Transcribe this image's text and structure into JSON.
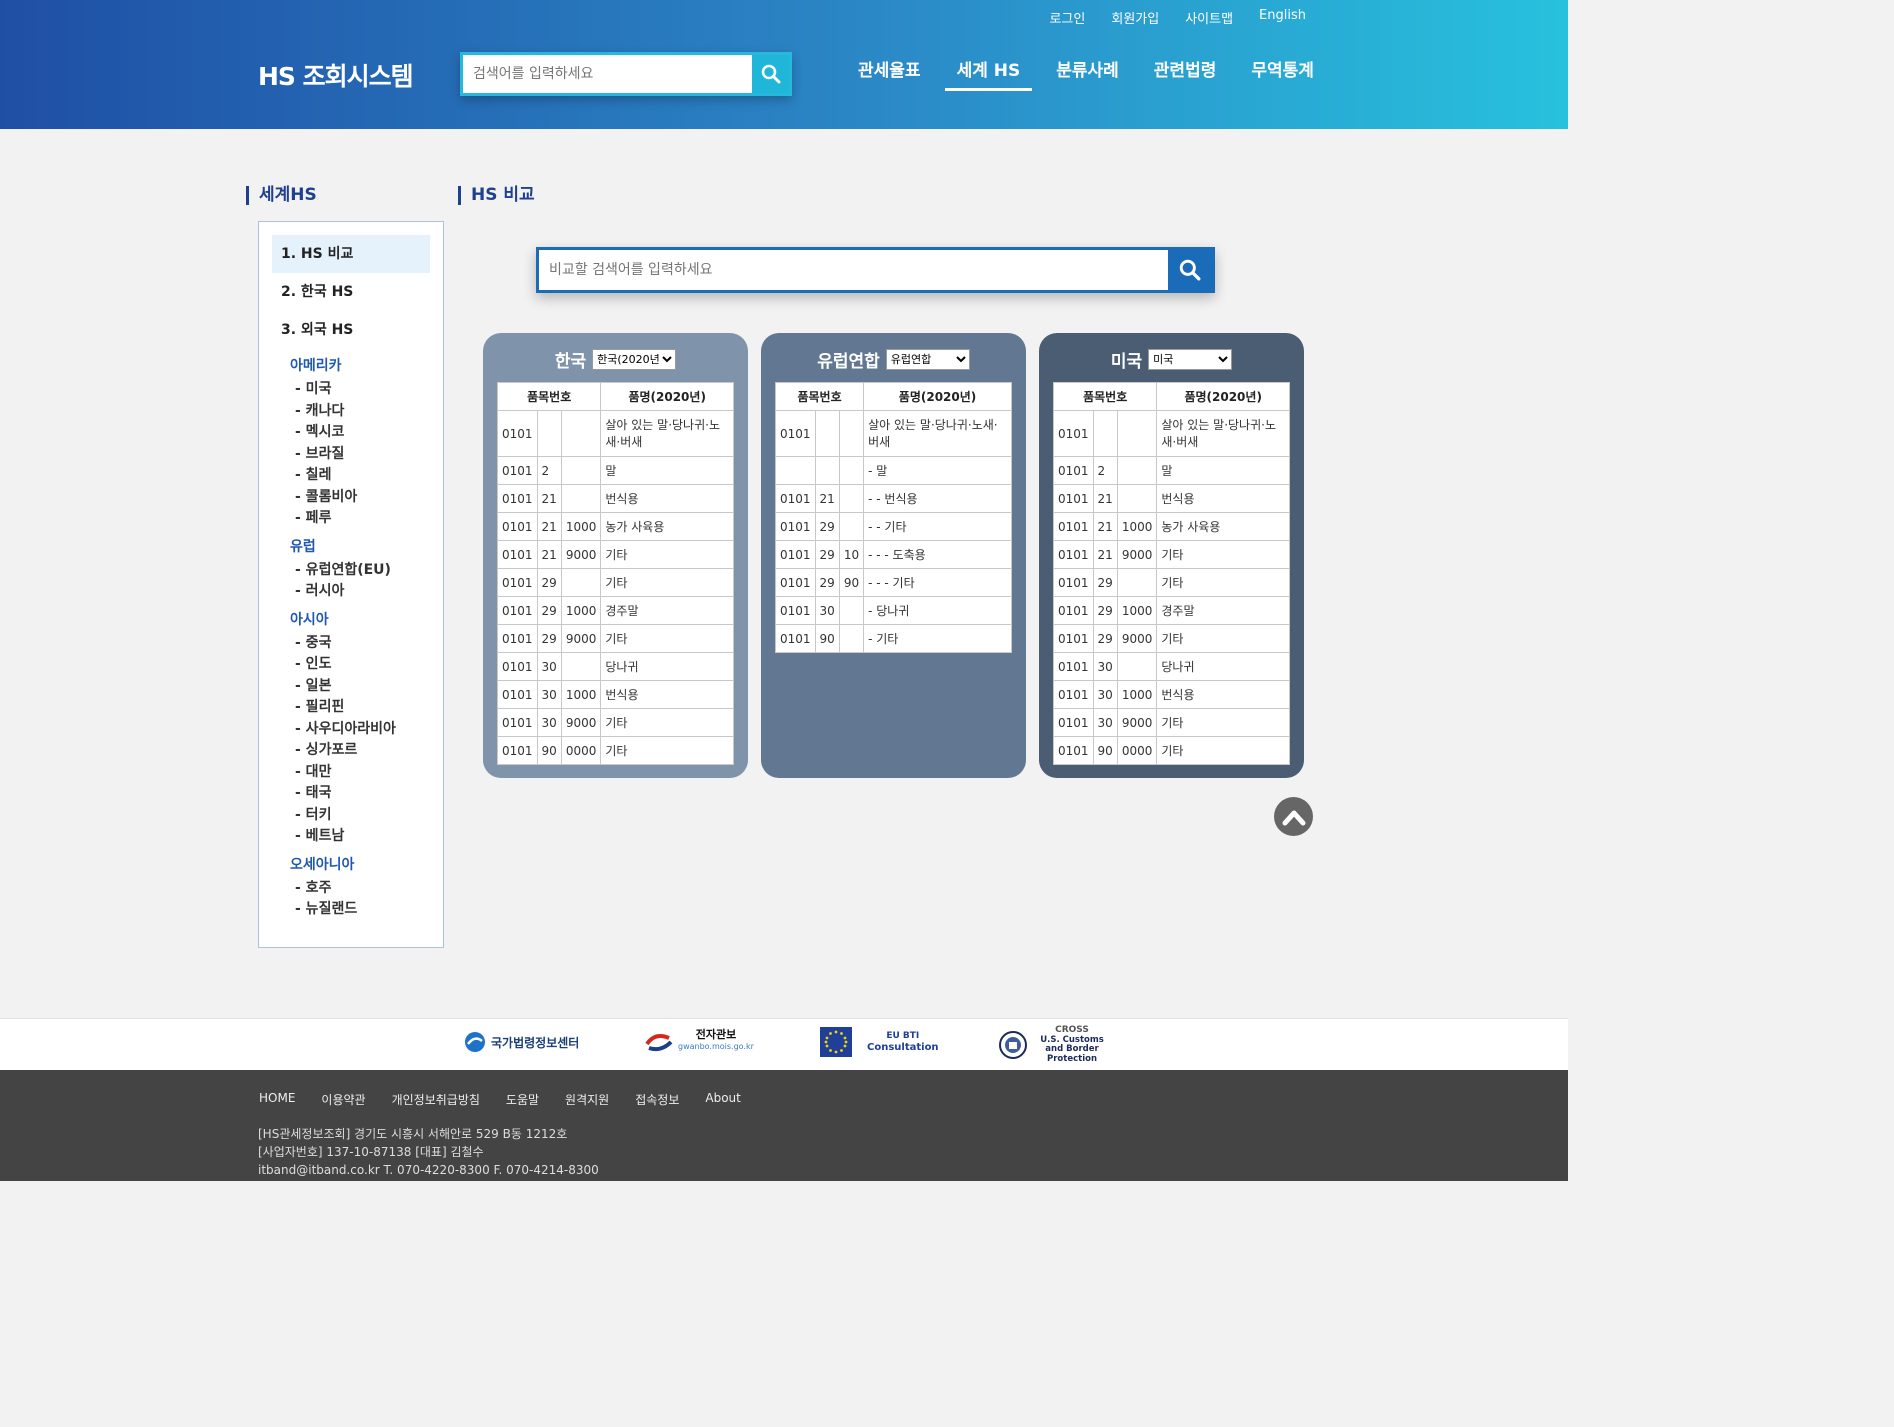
{
  "header": {
    "logo": "HS 조회시스템",
    "util_links": [
      "로그인",
      "회원가입",
      "사이트맵",
      "English"
    ],
    "search_placeholder": "검색어를 입력하세요",
    "gnb": [
      "관세율표",
      "세계 HS",
      "분류사례",
      "관련법령",
      "무역통계"
    ],
    "gnb_active": "세계 HS"
  },
  "lnb": {
    "title": "세계HS",
    "menu1": "1. HS 비교",
    "menu2": "2. 한국 HS",
    "menu3": "3. 외국 HS",
    "groups": [
      {
        "name": "아메리카",
        "items": [
          "- 미국",
          "- 캐나다",
          "- 멕시코",
          "- 브라질",
          "- 칠레",
          "- 콜롬비아",
          "- 페루"
        ]
      },
      {
        "name": "유럽",
        "items": [
          "- 유럽연합(EU)",
          "- 러시아"
        ]
      },
      {
        "name": "아시아",
        "items": [
          "- 중국",
          "- 인도",
          "- 일본",
          "- 필리핀",
          "- 사우디아라비아",
          "- 싱가포르",
          "- 대만",
          "- 태국",
          "- 터키",
          "- 베트남"
        ]
      },
      {
        "name": "오세아니아",
        "items": [
          "- 호주",
          "- 뉴질랜드"
        ]
      }
    ]
  },
  "main": {
    "title": "HS 비교",
    "search_placeholder": "비교할 검색어를 입력하세요",
    "col_code": "품목번호",
    "col_name": "품명(2020년)",
    "panels": [
      {
        "name": "한국",
        "select": "한국(2020년)",
        "color": "#7f93ab",
        "rows": [
          [
            "0101",
            "",
            "",
            "살아 있는 말·당나귀·노새·버새"
          ],
          [
            "0101",
            "2",
            "",
            "말"
          ],
          [
            "0101",
            "21",
            "",
            "번식용"
          ],
          [
            "0101",
            "21",
            "1000",
            "농가 사육용"
          ],
          [
            "0101",
            "21",
            "9000",
            "기타"
          ],
          [
            "0101",
            "29",
            "",
            "기타"
          ],
          [
            "0101",
            "29",
            "1000",
            "경주말"
          ],
          [
            "0101",
            "29",
            "9000",
            "기타"
          ],
          [
            "0101",
            "30",
            "",
            "당나귀"
          ],
          [
            "0101",
            "30",
            "1000",
            "번식용"
          ],
          [
            "0101",
            "30",
            "9000",
            "기타"
          ],
          [
            "0101",
            "90",
            "0000",
            "기타"
          ]
        ]
      },
      {
        "name": "유럽연합",
        "select": "유럽연합",
        "color": "#627791",
        "rows": [
          [
            "0101",
            "",
            "",
            "살아 있는 말·당나귀·노새·버새"
          ],
          [
            "",
            "",
            "",
            "- 말"
          ],
          [
            "0101",
            "21",
            "",
            "- - 번식용"
          ],
          [
            "0101",
            "29",
            "",
            "- - 기타"
          ],
          [
            "0101",
            "29",
            "10",
            "- - - 도축용"
          ],
          [
            "0101",
            "29",
            "90",
            "- - - 기타"
          ],
          [
            "0101",
            "30",
            "",
            "- 당나귀"
          ],
          [
            "0101",
            "90",
            "",
            "- 기타"
          ]
        ]
      },
      {
        "name": "미국",
        "select": "미국",
        "color": "#4b5d73",
        "rows": [
          [
            "0101",
            "",
            "",
            "살아 있는 말·당나귀·노새·버새"
          ],
          [
            "0101",
            "2",
            "",
            "말"
          ],
          [
            "0101",
            "21",
            "",
            "번식용"
          ],
          [
            "0101",
            "21",
            "1000",
            "농가 사육용"
          ],
          [
            "0101",
            "21",
            "9000",
            "기타"
          ],
          [
            "0101",
            "29",
            "",
            "기타"
          ],
          [
            "0101",
            "29",
            "1000",
            "경주말"
          ],
          [
            "0101",
            "29",
            "9000",
            "기타"
          ],
          [
            "0101",
            "30",
            "",
            "당나귀"
          ],
          [
            "0101",
            "30",
            "1000",
            "번식용"
          ],
          [
            "0101",
            "30",
            "9000",
            "기타"
          ],
          [
            "0101",
            "90",
            "0000",
            "기타"
          ]
        ]
      }
    ]
  },
  "partners": [
    {
      "name": "국가법령정보센터"
    },
    {
      "name": "전자관보",
      "sub": "gwanbo.mois.go.kr"
    },
    {
      "name": "EU BTI",
      "sub": "Consultation"
    },
    {
      "name": "CROSS",
      "sub": "U.S. Customs and Border Protection"
    }
  ],
  "footer": {
    "nav": [
      "HOME",
      "이용약관",
      "개인정보취급방침",
      "도움말",
      "원격지원",
      "접속정보",
      "About"
    ],
    "address": "[HS관세정보조회]  경기도 시흥시 서해안로 529 B동 1212호",
    "biz": "[사업자번호]  137-10-87138  [대표]  김철수",
    "contact": "itband@itband.co.kr   T. 070-4220-8300    F. 070-4214-8300"
  }
}
